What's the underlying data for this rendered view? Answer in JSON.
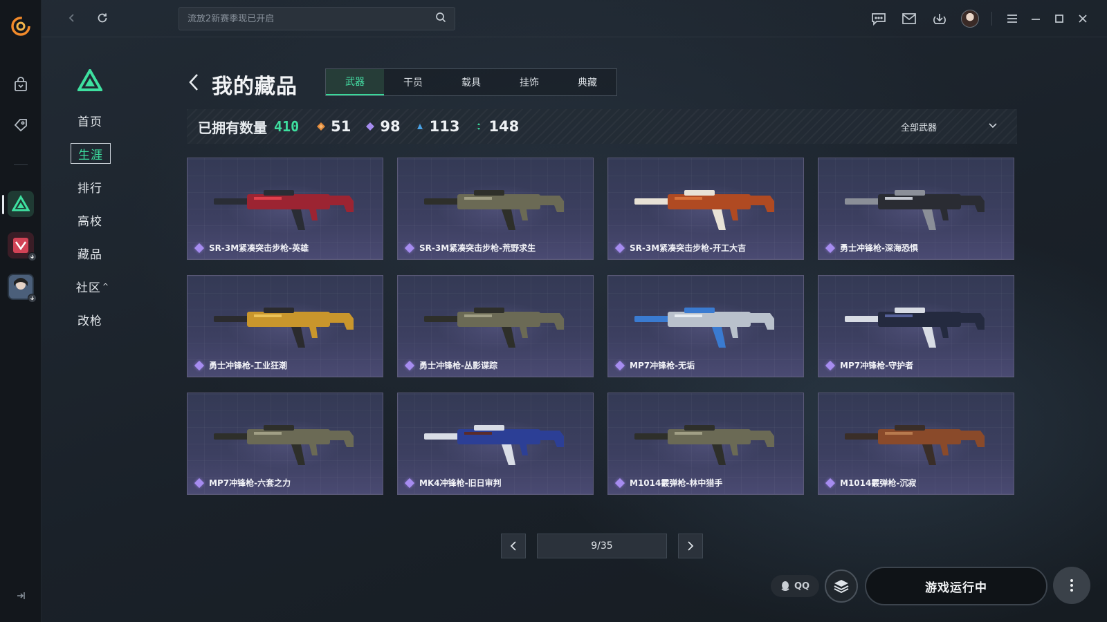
{
  "search": {
    "placeholder": "流放2新赛季现已开启"
  },
  "game_nav": {
    "items": [
      {
        "label": "首页"
      },
      {
        "label": "生涯"
      },
      {
        "label": "排行"
      },
      {
        "label": "高校"
      },
      {
        "label": "藏品"
      },
      {
        "label": "社区"
      },
      {
        "label": "改枪"
      }
    ],
    "community_caret": "^"
  },
  "page": {
    "title": "我的藏品"
  },
  "tabs": [
    {
      "label": "武器"
    },
    {
      "label": "干员"
    },
    {
      "label": "载具"
    },
    {
      "label": "挂饰"
    },
    {
      "label": "典藏"
    }
  ],
  "stats": {
    "owned_label": "已拥有数量",
    "owned_count": "410",
    "orange": "51",
    "purple": "98",
    "blue": "113",
    "green": "148",
    "filter_label": "全部武器"
  },
  "colors": {
    "accent": "#3edf9f",
    "orange_quality": "#e08a3c",
    "purple_quality": "#a68cf0",
    "blue_quality": "#4aa3e6",
    "green_quality": "#3ad79a"
  },
  "items": [
    {
      "name": "SR-3M紧凑突击步枪-英雄",
      "gun": "red"
    },
    {
      "name": "SR-3M紧凑突击步枪-荒野求生",
      "gun": "camo"
    },
    {
      "name": "SR-3M紧凑突击步枪-开工大吉",
      "gun": "orange"
    },
    {
      "name": "勇士冲锋枪-深海恐惧",
      "gun": "dark"
    },
    {
      "name": "勇士冲锋枪-工业狂潮",
      "gun": "yellow"
    },
    {
      "name": "勇士冲锋枪-丛影谍踪",
      "gun": "camo"
    },
    {
      "name": "MP7冲锋枪-无垢",
      "gun": "white"
    },
    {
      "name": "MP7冲锋枪-守护者",
      "gun": "navy"
    },
    {
      "name": "MP7冲锋枪-六套之力",
      "gun": "camo"
    },
    {
      "name": "MK4冲锋枪-旧日审判",
      "gun": "blue"
    },
    {
      "name": "M1014霰弹枪-林中猎手",
      "gun": "camo"
    },
    {
      "name": "M1014霰弹枪-沉寂",
      "gun": "rust"
    }
  ],
  "pager": {
    "text": "9/35"
  },
  "bottom": {
    "qq_label": "QQ",
    "play_label": "游戏运行中"
  }
}
